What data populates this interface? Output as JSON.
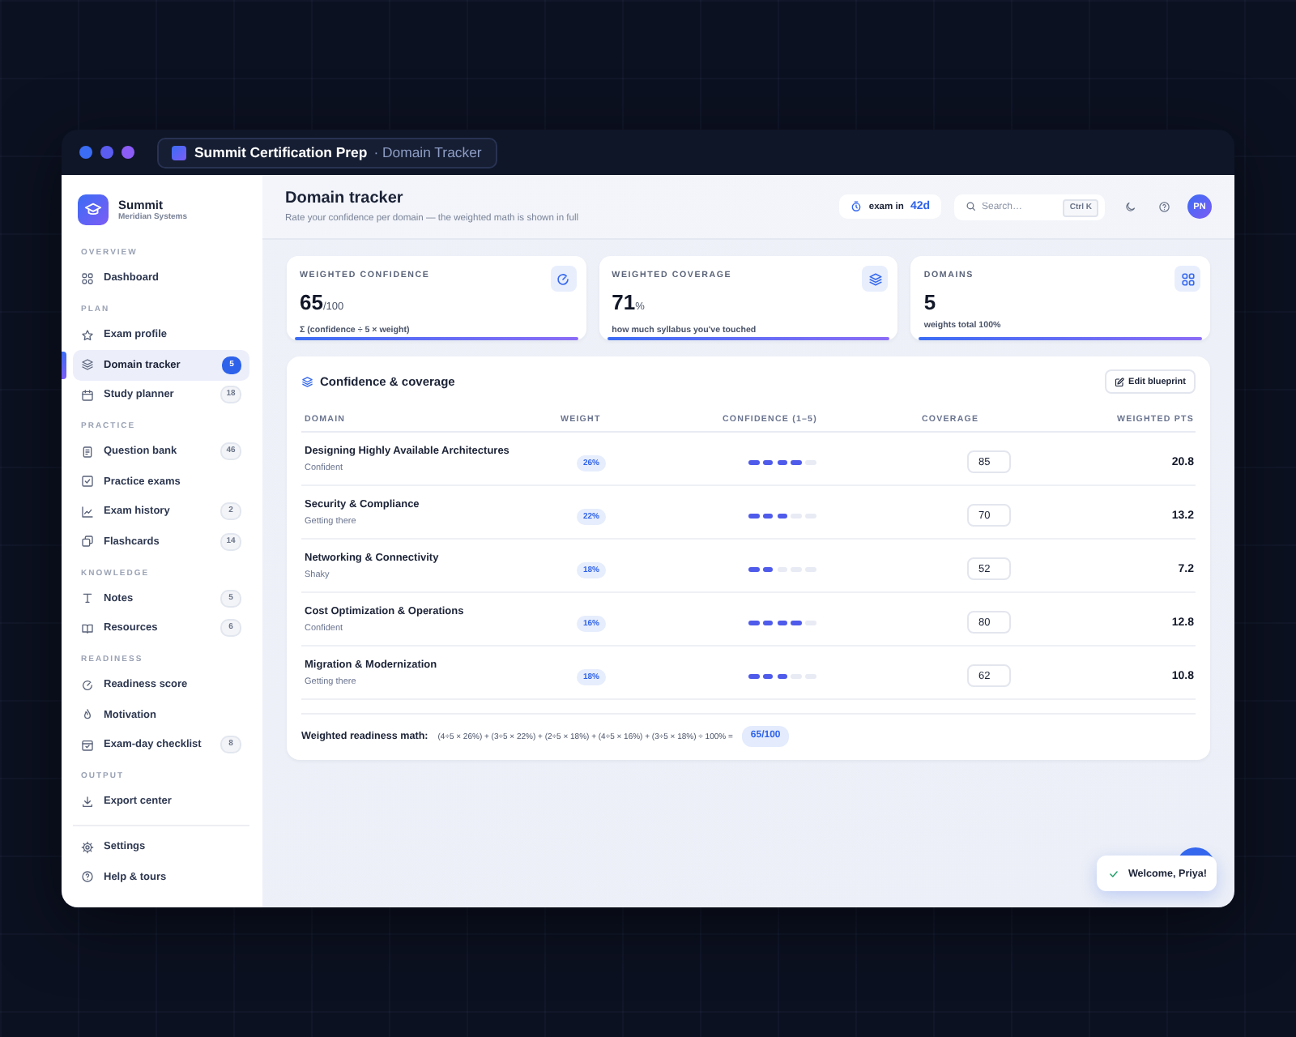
{
  "window": {
    "title": "Summit Certification Prep",
    "breadcrumb": "· Domain Tracker"
  },
  "sidebar": {
    "brand": {
      "name": "Summit",
      "organization": "Meridian Systems"
    },
    "sections": [
      {
        "label": "OVERVIEW",
        "items": [
          {
            "label": "Dashboard",
            "selected": false
          }
        ]
      },
      {
        "label": "PLAN",
        "items": [
          {
            "label": "Exam profile",
            "selected": false
          },
          {
            "label": "Domain tracker",
            "selected": true,
            "badge": "5"
          },
          {
            "label": "Study planner",
            "selected": false,
            "badge": "18"
          }
        ]
      },
      {
        "label": "PRACTICE",
        "items": [
          {
            "label": "Question bank",
            "selected": false,
            "badge": "46"
          },
          {
            "label": "Practice exams",
            "selected": false
          },
          {
            "label": "Exam history",
            "selected": false,
            "badge": "2"
          },
          {
            "label": "Flashcards",
            "selected": false,
            "badge": "14"
          }
        ]
      },
      {
        "label": "KNOWLEDGE",
        "items": [
          {
            "label": "Notes",
            "selected": false,
            "badge": "5"
          },
          {
            "label": "Resources",
            "selected": false,
            "badge": "6"
          }
        ]
      },
      {
        "label": "READINESS",
        "items": [
          {
            "label": "Readiness score",
            "selected": false
          },
          {
            "label": "Motivation",
            "selected": false
          },
          {
            "label": "Exam-day checklist",
            "selected": false,
            "badge": "8"
          }
        ]
      },
      {
        "label": "OUTPUT",
        "items": [
          {
            "label": "Export center",
            "selected": false
          }
        ]
      }
    ],
    "footer_items": [
      {
        "label": "Settings",
        "selected": false
      },
      {
        "label": "Help & tours",
        "selected": false
      }
    ]
  },
  "header": {
    "title": "Domain tracker",
    "subtitle": "Rate your confidence per domain — the weighted math is shown in full",
    "countdown": {
      "label": "exam in",
      "value": "42d"
    },
    "search": {
      "placeholder": "Search…",
      "shortcut": "Ctrl K"
    },
    "avatar": "PN"
  },
  "stats": [
    {
      "label": "WEIGHTED CONFIDENCE",
      "value": "65",
      "unit": "/100",
      "note": "Σ (confidence ÷ 5 × weight)"
    },
    {
      "label": "WEIGHTED COVERAGE",
      "value": "71",
      "unit": "%",
      "note": "how much syllabus you've touched"
    },
    {
      "label": "DOMAINS",
      "value": "5",
      "note": "weights total 100%"
    }
  ],
  "table": {
    "title": "Confidence & coverage",
    "action": "Edit blueprint",
    "columns": [
      "DOMAIN",
      "WEIGHT",
      "CONFIDENCE (1–5)",
      "COVERAGE",
      "WEIGHTED PTS"
    ],
    "rows": [
      {
        "domain": "Designing Highly Available Architectures",
        "status": "Confident",
        "weight": "26%",
        "stars": 4,
        "coverage": "85",
        "points": "20.8"
      },
      {
        "domain": "Security & Compliance",
        "status": "Getting there",
        "weight": "22%",
        "stars": 3,
        "coverage": "70",
        "points": "13.2"
      },
      {
        "domain": "Networking & Connectivity",
        "status": "Shaky",
        "weight": "18%",
        "stars": 2,
        "coverage": "52",
        "points": "7.2"
      },
      {
        "domain": "Cost Optimization & Operations",
        "status": "Confident",
        "weight": "16%",
        "stars": 4,
        "coverage": "80",
        "points": "12.8"
      },
      {
        "domain": "Migration & Modernization",
        "status": "Getting there",
        "weight": "18%",
        "stars": 3,
        "coverage": "62",
        "points": "10.8"
      }
    ],
    "math": {
      "label": "Weighted readiness math:",
      "formula": "(4÷5 × 26%) + (3÷5 × 22%) + (2÷5 × 18%) + (4÷5 × 16%) + (3÷5 × 18%) ÷ 100% =",
      "result": "65/100"
    }
  },
  "toast": {
    "message": "Welcome, Priya!"
  }
}
